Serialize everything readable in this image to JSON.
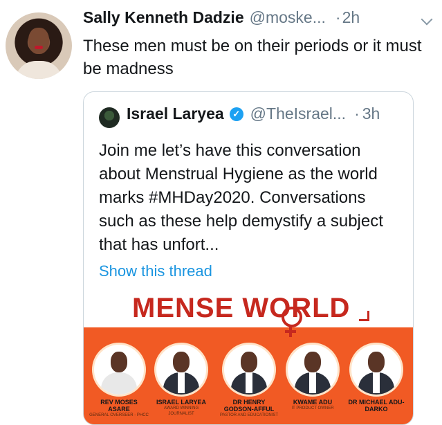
{
  "tweet": {
    "author_name": "Sally Kenneth Dadzie",
    "author_handle": "@moske...",
    "separator": "·",
    "time": "2h",
    "text": "These men must be on their periods or it must be madness"
  },
  "quoted_tweet": {
    "author_name": "Israel Laryea",
    "verified_badge": "✓",
    "author_handle": "@TheIsrael...",
    "separator": "·",
    "time": "3h",
    "text": "Join me let’s have this conversation about Menstrual Hygiene as the world marks #MHDay2020. Conversations such as these help demystify a subject that has unfort...",
    "show_thread_label": "Show this thread"
  },
  "poster": {
    "title": "MENSE WORLD",
    "guests": [
      {
        "name": "REV MOSES ASARE",
        "role": "GENERAL OVERSEER - PHCC"
      },
      {
        "name": "ISRAEL LARYEA",
        "role": "AWARD WINNING JOURNALIST"
      },
      {
        "name": "DR HENRY GODSON-AFFUL",
        "role": "PASTOR AND EDUCATIONIST"
      },
      {
        "name": "KWAME ADU",
        "role": "IT PRODUCT OWNER"
      },
      {
        "name": "DR MICHAEL ADU-DARKO",
        "role": ""
      }
    ]
  },
  "icons": {
    "more_menu": "chevron-down-icon",
    "verified": "verified-badge-icon"
  }
}
